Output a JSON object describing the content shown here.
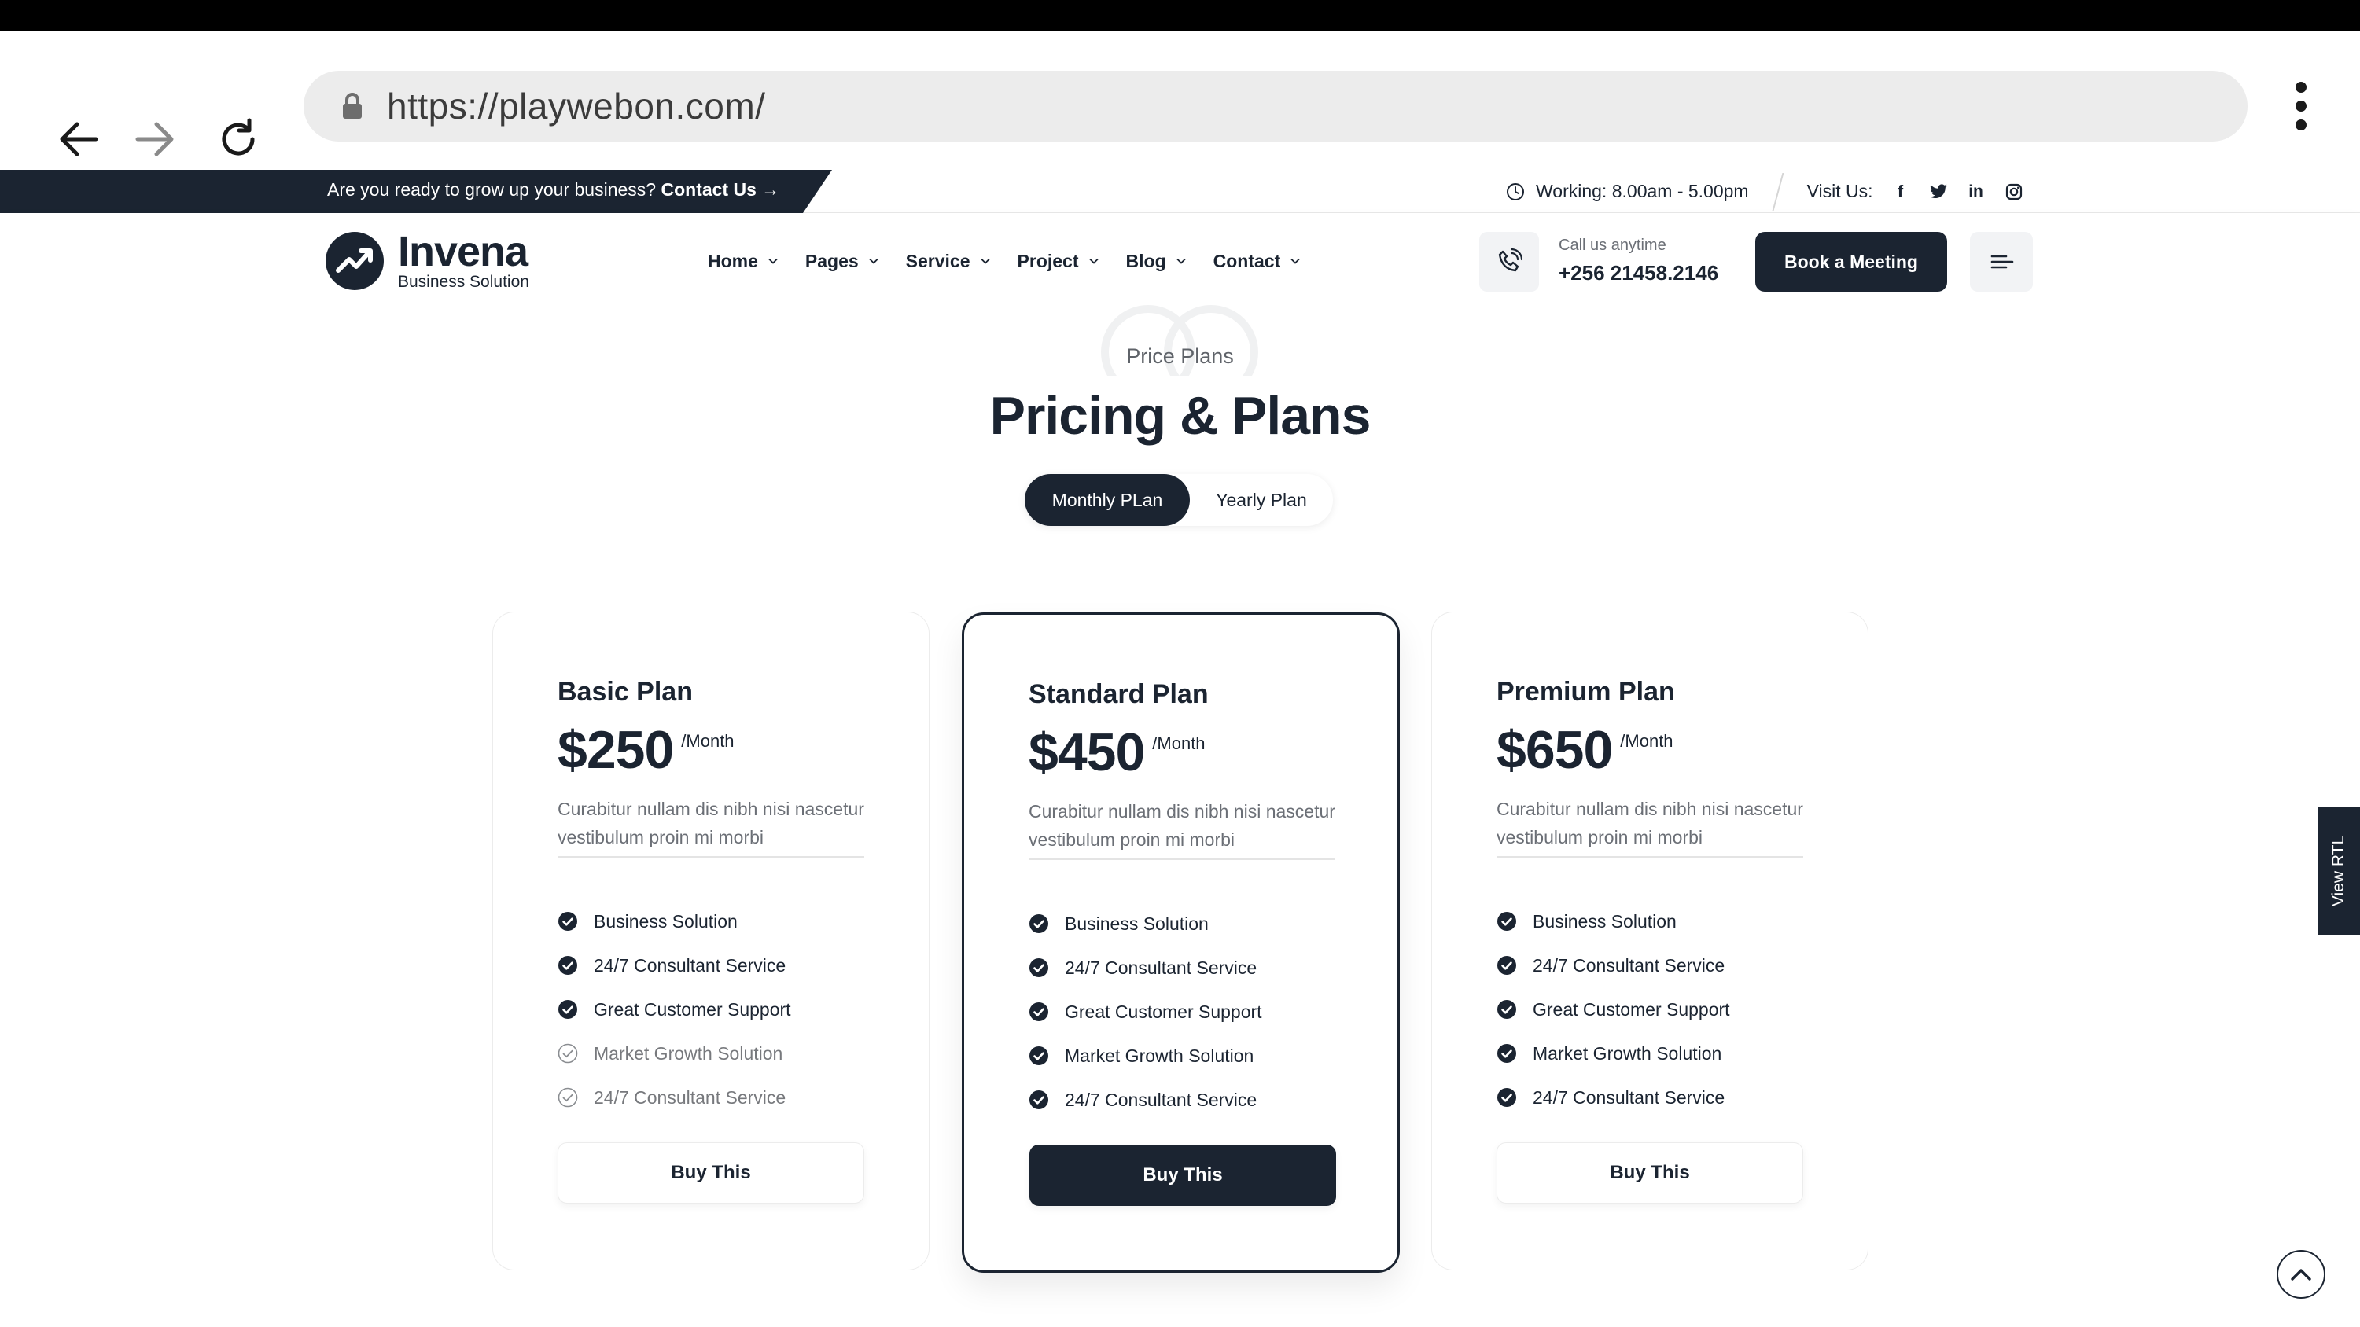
{
  "browser": {
    "url": "https://playwebon.com/"
  },
  "topbar": {
    "message": "Are you ready to grow up your business?",
    "contact_link": "Contact Us",
    "working_hours": "Working: 8.00am - 5.00pm",
    "visit_label": "Visit Us:",
    "social": [
      "facebook",
      "twitter",
      "linkedin",
      "instagram"
    ]
  },
  "header": {
    "logo_name": "Invena",
    "logo_sub": "Business Solution",
    "menu": [
      "Home",
      "Pages",
      "Service",
      "Project",
      "Blog",
      "Contact"
    ],
    "call_label": "Call us anytime",
    "call_number": "+256 21458.2146",
    "book_button": "Book a Meeting"
  },
  "pricing": {
    "subtitle": "Price Plans",
    "title": "Pricing & Plans",
    "toggle": {
      "monthly": "Monthly PLan",
      "yearly": "Yearly Plan",
      "selected": "monthly"
    },
    "plans": [
      {
        "name": "Basic Plan",
        "price": "$250",
        "period": "/Month",
        "description": "Curabitur nullam dis nibh nisi nascetur vestibulum proin mi morbi",
        "features": [
          {
            "label": "Business Solution",
            "included": true
          },
          {
            "label": "24/7 Consultant Service",
            "included": true
          },
          {
            "label": "Great Customer Support",
            "included": true
          },
          {
            "label": "Market Growth Solution",
            "included": false
          },
          {
            "label": "24/7 Consultant Service",
            "included": false
          }
        ],
        "button": "Buy This",
        "featured": false
      },
      {
        "name": "Standard Plan",
        "price": "$450",
        "period": "/Month",
        "description": "Curabitur nullam dis nibh nisi nascetur vestibulum proin mi morbi",
        "features": [
          {
            "label": "Business Solution",
            "included": true
          },
          {
            "label": "24/7 Consultant Service",
            "included": true
          },
          {
            "label": "Great Customer Support",
            "included": true
          },
          {
            "label": "Market Growth Solution",
            "included": true
          },
          {
            "label": "24/7 Consultant Service",
            "included": true
          }
        ],
        "button": "Buy This",
        "featured": true
      },
      {
        "name": "Premium Plan",
        "price": "$650",
        "period": "/Month",
        "description": "Curabitur nullam dis nibh nisi nascetur vestibulum proin mi morbi",
        "features": [
          {
            "label": "Business Solution",
            "included": true
          },
          {
            "label": "24/7 Consultant Service",
            "included": true
          },
          {
            "label": "Great Customer Support",
            "included": true
          },
          {
            "label": "Market Growth Solution",
            "included": true
          },
          {
            "label": "24/7 Consultant Service",
            "included": true
          }
        ],
        "button": "Buy This",
        "featured": false
      }
    ]
  },
  "side": {
    "rtl_label": "View RTL"
  },
  "colors": {
    "primary": "#1b2431",
    "muted_text": "#6b6f76",
    "border": "#ececec"
  }
}
